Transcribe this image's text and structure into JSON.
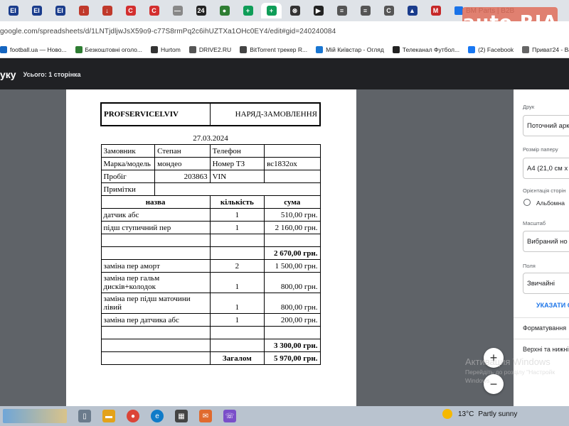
{
  "browser": {
    "tab_favicons": [
      {
        "icon": "tab-icon-1",
        "color": "#1a3c8c",
        "glyph": "EI"
      },
      {
        "icon": "tab-icon-2",
        "color": "#1a3c8c",
        "glyph": "EI"
      },
      {
        "icon": "tab-icon-3",
        "color": "#1a3c8c",
        "glyph": "EI"
      },
      {
        "icon": "tab-icon-4",
        "color": "#c0392b",
        "glyph": "↓"
      },
      {
        "icon": "tab-icon-5",
        "color": "#c0392b",
        "glyph": "↓"
      },
      {
        "icon": "tab-icon-6",
        "color": "#d32f2f",
        "glyph": "C"
      },
      {
        "icon": "tab-icon-7",
        "color": "#d32f2f",
        "glyph": "C"
      },
      {
        "icon": "tab-icon-8",
        "color": "#888888",
        "glyph": "—"
      },
      {
        "icon": "tab-icon-9",
        "color": "#222222",
        "glyph": "24"
      },
      {
        "icon": "tab-icon-10",
        "color": "#2e7d32",
        "glyph": "●"
      },
      {
        "icon": "tab-icon-11",
        "color": "#0f9d58",
        "glyph": "+"
      },
      {
        "icon": "tab-icon-12",
        "color": "#0f9d58",
        "glyph": "+"
      },
      {
        "icon": "tab-icon-13",
        "color": "#333333",
        "glyph": "⊗"
      },
      {
        "icon": "tab-icon-14",
        "color": "#222222",
        "glyph": "▶"
      },
      {
        "icon": "tab-icon-15",
        "color": "#555555",
        "glyph": "≡"
      },
      {
        "icon": "tab-icon-16",
        "color": "#555555",
        "glyph": "≡"
      },
      {
        "icon": "tab-icon-17",
        "color": "#555555",
        "glyph": "C"
      },
      {
        "icon": "tab-icon-18",
        "color": "#1a3c8c",
        "glyph": "▲"
      },
      {
        "icon": "tab-icon-19",
        "color": "#c62828",
        "glyph": "M"
      }
    ],
    "tab_title": "BM Parts | B2B",
    "autoria_logo": "auto RIA",
    "url": "google.com/spreadsheets/d/1LNTjdljwJsX59o9-c77S8rmPq2c6ihUZTXa1OHc0EY4/edit#gid=240240084",
    "bookmarks": [
      {
        "label": "football.ua — Ново...",
        "color": "#1565c0"
      },
      {
        "label": "Безкоштовні оголо...",
        "color": "#2e7d32"
      },
      {
        "label": "Hurtom",
        "color": "#333333"
      },
      {
        "label": "DRIVE2.RU",
        "color": "#555555"
      },
      {
        "label": "BitTorrent трекер R...",
        "color": "#444444"
      },
      {
        "label": "Мій Київстар - Огляд",
        "color": "#1976d2"
      },
      {
        "label": "Телеканал Футбол...",
        "color": "#222222"
      },
      {
        "label": "(2) Facebook",
        "color": "#1877f2"
      },
      {
        "label": "Приват24 - Ваш жи...",
        "color": "#666666"
      }
    ]
  },
  "print_header": {
    "title": "уку",
    "page_count": "Усього: 1 сторінка"
  },
  "order": {
    "company": "PROFSERVICELVIV",
    "doc_title": "НАРЯД-ЗАМОВЛЕННЯ",
    "date": "27.03.2024",
    "customer_label": "Замовник",
    "customer_value": "Степан",
    "phone_label": "Телефон",
    "phone_value": "",
    "make_label": "Марка/модель",
    "make_value": "мондео",
    "plate_label": "Номер ТЗ",
    "plate_value": "вс1832ох",
    "mileage_label": "Пробіг",
    "mileage_value": "203863",
    "vin_label": "VIN",
    "vin_value": "",
    "notes_label": "Примітки",
    "col_name": "назва",
    "col_qty": "кількість",
    "col_sum": "сума",
    "parts": [
      {
        "name": "датчик абс",
        "qty": "1",
        "sum": "510,00 грн."
      },
      {
        "name": "підш ступичний пер",
        "qty": "1",
        "sum": "2 160,00 грн."
      }
    ],
    "parts_total": "2 670,00 грн.",
    "works": [
      {
        "name": "заміна пер аморт",
        "qty": "2",
        "sum": "1 500,00 грн."
      },
      {
        "name": "заміна пер гальм дисків+колодок",
        "qty": "1",
        "sum": "800,00 грн."
      },
      {
        "name": "заміна пер підш маточини лівий",
        "qty": "1",
        "sum": "800,00 грн."
      },
      {
        "name": "заміна пер датчика абс",
        "qty": "1",
        "sum": "200,00 грн."
      }
    ],
    "works_total": "3 300,00 грн.",
    "grand_label": "Загалом",
    "grand_total": "5 970,00 грн."
  },
  "print_panel": {
    "print_label": "Друк",
    "print_value": "Поточний арк",
    "paper_label": "Розмір паперу",
    "paper_value": "A4 (21,0 см x",
    "orientation_label": "Орієнтація сторін",
    "orientation_option": "Альбомна",
    "scale_label": "Масштаб",
    "scale_value": "Вибраний но",
    "margins_label": "Поля",
    "margins_value": "Звичайні",
    "custom_link": "УКАЗАТИ С",
    "formatting_item": "Форматування",
    "headers_item": "Верхні та нижні"
  },
  "zoom": {
    "plus": "+",
    "minus": "−"
  },
  "watermark": {
    "line1": "Активация Windows",
    "line2": "Перейдіть до розділу \"Настройк",
    "line3": "Windows."
  },
  "taskbar": {
    "temperature": "13°C",
    "weather": "Partly sunny"
  }
}
